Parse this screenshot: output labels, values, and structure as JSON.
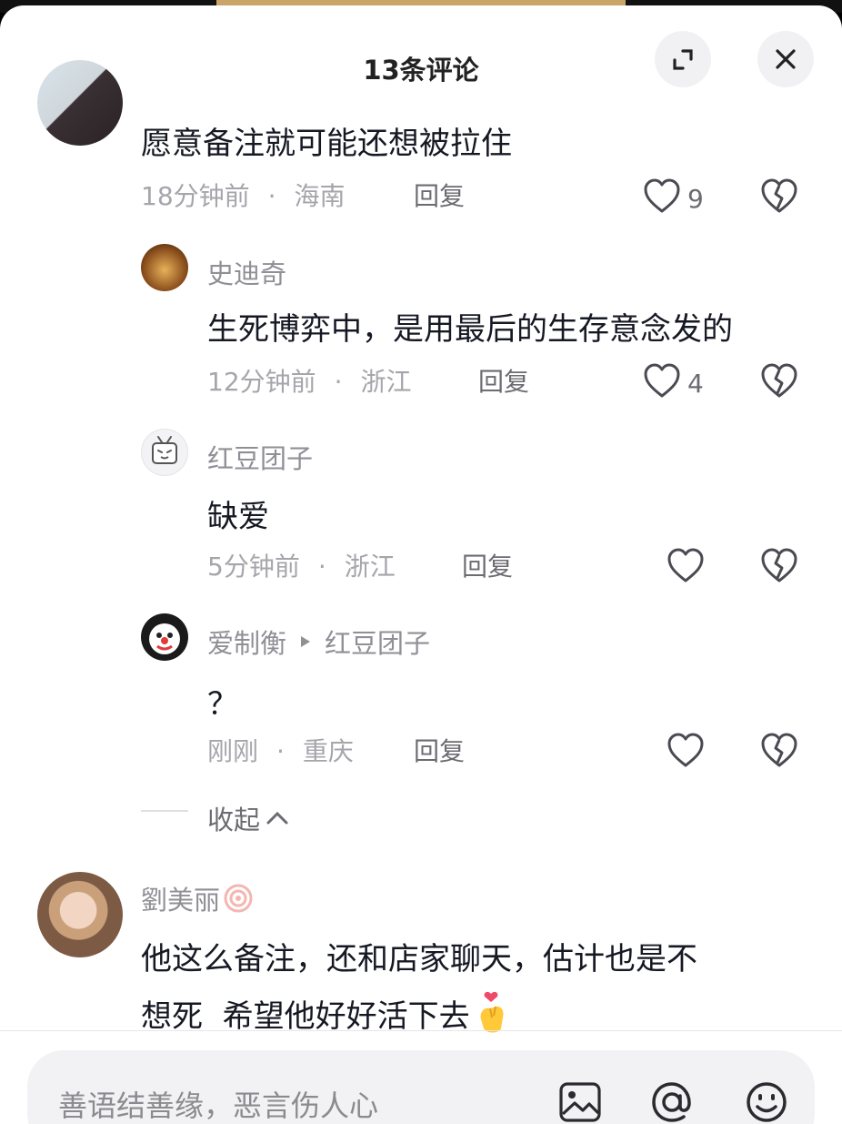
{
  "header": {
    "title": "13条评论"
  },
  "comments": [
    {
      "text": "愿意备注就可能还想被拉住",
      "time": "18分钟前",
      "location": "海南",
      "reply": "回复",
      "likes": "9"
    },
    {
      "user": "史迪奇",
      "text": "生死博弈中，是用最后的生存意念发的",
      "time": "12分钟前",
      "location": "浙江",
      "reply": "回复",
      "likes": "4"
    },
    {
      "user": "红豆团子",
      "text": "缺爱",
      "time": "5分钟前",
      "location": "浙江",
      "reply": "回复"
    },
    {
      "user": "爱制衡",
      "reply_to": "红豆团子",
      "text": "？",
      "time": "刚刚",
      "location": "重庆",
      "reply": "回复"
    },
    {
      "user": "劉美丽",
      "text_line1": "他这么备注，还和店家聊天，估计也是不",
      "text_line2": "想死  希望他好好活下去"
    }
  ],
  "collapse": {
    "label": "收起"
  },
  "separator": "·",
  "input": {
    "placeholder": "善语结善缘，恶言伤人心"
  },
  "colors": {
    "accent_muted": "#a5a5ab",
    "text": "#161823",
    "bg": "#ffffff"
  },
  "icons": [
    "expand-icon",
    "close-icon",
    "heart-icon",
    "dislike-icon",
    "image-icon",
    "mention-icon",
    "emoji-icon"
  ]
}
